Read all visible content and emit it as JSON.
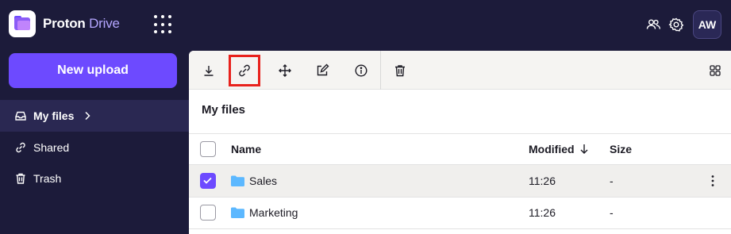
{
  "brand": {
    "name": "Proton",
    "product": "Drive"
  },
  "topbar": {
    "apps_icon": "apps-grid-icon",
    "contacts_icon": "contacts-icon",
    "settings_icon": "gear-icon",
    "avatar_initials": "AW"
  },
  "sidebar": {
    "new_upload_label": "New upload",
    "items": [
      {
        "label": "My files",
        "icon": "inbox-icon",
        "active": true
      },
      {
        "label": "Shared",
        "icon": "link-icon",
        "active": false
      },
      {
        "label": "Trash",
        "icon": "trash-icon",
        "active": false
      }
    ]
  },
  "toolbar": {
    "buttons": [
      "download-icon",
      "link-icon",
      "move-icon",
      "rename-icon",
      "info-icon",
      "trash-icon"
    ],
    "highlighted": "link-icon",
    "layout_icon": "grid-view-icon"
  },
  "main": {
    "title": "My files",
    "columns": {
      "name": "Name",
      "modified": "Modified",
      "size": "Size"
    },
    "sort_indicator": "arrow-down-icon",
    "rows": [
      {
        "name": "Sales",
        "modified": "11:26",
        "size": "-",
        "selected": true
      },
      {
        "name": "Marketing",
        "modified": "11:26",
        "size": "-",
        "selected": false
      }
    ]
  },
  "colors": {
    "sidebar_bg": "#1c1b3a",
    "accent": "#6d4aff",
    "highlight_border": "#e8211c",
    "folder": "#5cb8ff"
  }
}
